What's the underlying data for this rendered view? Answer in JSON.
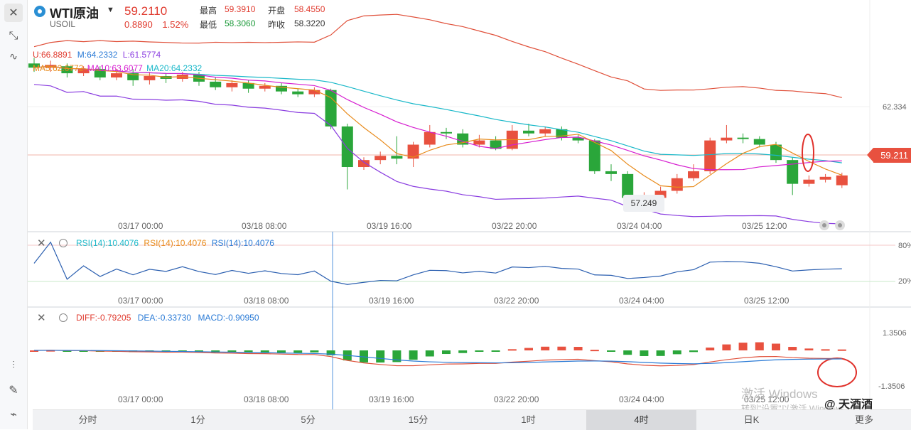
{
  "header": {
    "symbol": "WTI原油",
    "code": "USOIL",
    "price": "59.2110",
    "change": "0.8890",
    "change_pct": "1.52%",
    "high_label": "最高",
    "high": "59.3910",
    "open_label": "开盘",
    "open": "58.4550",
    "low_label": "最低",
    "low": "58.3060",
    "prev_label": "昨收",
    "prev": "58.3220"
  },
  "boll": {
    "u": "U:66.8891",
    "m": "M:64.2332",
    "l": "L:61.5774"
  },
  "ma": {
    "ma5": "MA5:62.6772",
    "ma10": "MA10:63.6077",
    "ma20": "MA20:64.2332"
  },
  "price_axis": {
    "level": "62.334",
    "current": "59.211",
    "low_marker": "57.249"
  },
  "time_labels": [
    "03/17 00:00",
    "03/18 08:00",
    "03/19 16:00",
    "03/22 20:00",
    "03/24 04:00",
    "03/25 12:00"
  ],
  "rsi": {
    "a": "RSI(14):10.4076",
    "b": "RSI(14):10.4076",
    "c": "RSI(14):10.4076",
    "hi": "80%",
    "lo": "20%"
  },
  "macd": {
    "diff": "DIFF:-0.79205",
    "dea": "DEA:-0.33730",
    "macd": "MACD:-0.90950",
    "top": "1.3506",
    "bottom": "-1.3506"
  },
  "tabs": [
    "分时",
    "1分",
    "5分",
    "15分",
    "1时",
    "4时",
    "日K",
    "更多"
  ],
  "active_tab": "4时",
  "watermark": {
    "line1": "激活 Windows",
    "line2": "转到\"设置\"以激活 Windows。",
    "account": "@ 天酒酒"
  },
  "colors": {
    "up": "#e8513f",
    "down": "#2aa63a",
    "accent": "#2a8fd4"
  },
  "chart_data": {
    "type": "candlestick",
    "candles": [
      [
        67.2,
        66.9,
        67.6,
        66.6
      ],
      [
        66.9,
        67.1,
        67.4,
        66.6
      ],
      [
        67.0,
        66.5,
        67.2,
        66.2
      ],
      [
        66.5,
        66.8,
        67.0,
        66.3
      ],
      [
        66.8,
        66.2,
        67.0,
        66.0
      ],
      [
        66.2,
        66.5,
        66.8,
        66.0
      ],
      [
        66.5,
        66.0,
        66.8,
        65.6
      ],
      [
        66.0,
        66.3,
        66.6,
        65.7
      ],
      [
        66.3,
        66.1,
        66.5,
        65.8
      ],
      [
        66.1,
        66.4,
        66.6,
        65.9
      ],
      [
        66.4,
        65.9,
        66.6,
        65.6
      ],
      [
        65.9,
        65.5,
        66.2,
        65.3
      ],
      [
        65.5,
        65.8,
        66.0,
        65.2
      ],
      [
        65.8,
        65.4,
        66.0,
        65.1
      ],
      [
        65.4,
        65.6,
        65.8,
        65.2
      ],
      [
        65.6,
        65.2,
        65.8,
        65.0
      ],
      [
        65.2,
        65.0,
        65.4,
        64.8
      ],
      [
        65.0,
        65.3,
        65.5,
        64.8
      ],
      [
        65.3,
        62.7,
        65.4,
        62.5
      ],
      [
        62.7,
        59.8,
        62.9,
        58.2
      ],
      [
        59.8,
        60.3,
        60.5,
        59.6
      ],
      [
        60.3,
        60.6,
        60.9,
        60.0
      ],
      [
        60.6,
        60.4,
        62.0,
        60.0
      ],
      [
        60.4,
        61.4,
        61.6,
        59.8
      ],
      [
        61.4,
        62.3,
        62.8,
        61.2
      ],
      [
        62.3,
        62.2,
        62.6,
        61.8
      ],
      [
        62.2,
        61.4,
        62.5,
        61.2
      ],
      [
        61.4,
        61.7,
        62.1,
        61.2
      ],
      [
        61.7,
        61.1,
        62.0,
        61.0
      ],
      [
        61.1,
        62.4,
        62.8,
        61.0
      ],
      [
        62.4,
        62.2,
        62.9,
        62.0
      ],
      [
        62.2,
        62.5,
        62.7,
        62.0
      ],
      [
        62.5,
        61.9,
        62.7,
        61.7
      ],
      [
        61.9,
        61.7,
        62.1,
        61.5
      ],
      [
        61.7,
        59.5,
        61.8,
        59.3
      ],
      [
        59.5,
        59.3,
        60.0,
        58.8
      ],
      [
        59.3,
        57.6,
        59.5,
        57.2
      ],
      [
        57.5,
        57.8,
        58.0,
        57.3
      ],
      [
        57.6,
        58.1,
        58.4,
        57.4
      ],
      [
        58.1,
        59.0,
        59.3,
        57.9
      ],
      [
        59.0,
        59.5,
        60.0,
        58.8
      ],
      [
        59.5,
        61.7,
        61.9,
        59.3
      ],
      [
        61.7,
        61.9,
        62.8,
        61.5
      ],
      [
        61.9,
        61.8,
        62.2,
        61.5
      ],
      [
        61.8,
        61.4,
        62.0,
        61.2
      ],
      [
        61.4,
        60.3,
        61.6,
        60.1
      ],
      [
        60.3,
        58.6,
        60.5,
        57.8
      ],
      [
        58.6,
        58.9,
        59.2,
        58.4
      ],
      [
        58.9,
        59.1,
        59.3,
        58.7
      ],
      [
        58.5,
        59.2,
        59.4,
        58.3
      ]
    ],
    "ylim": [
      56.5,
      69.5
    ]
  }
}
